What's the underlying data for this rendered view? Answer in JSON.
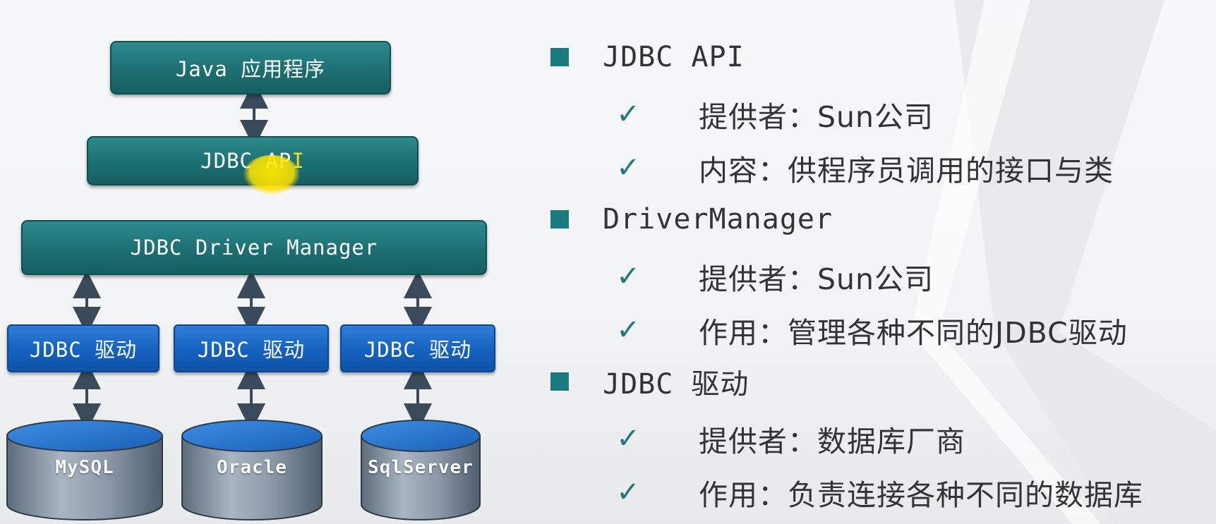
{
  "diagram": {
    "app_box": {
      "label": "Java 应用程序"
    },
    "api_box": {
      "label_main": "JDBC AP",
      "label_highlight": "I"
    },
    "manager_box": {
      "label": "JDBC Driver Manager"
    },
    "drivers": [
      {
        "label": "JDBC 驱动"
      },
      {
        "label": "JDBC 驱动"
      },
      {
        "label": "JDBC 驱动"
      }
    ],
    "databases": [
      {
        "label": "MySQL"
      },
      {
        "label": "Oracle"
      },
      {
        "label": "SqlServer"
      }
    ],
    "colors": {
      "teal_box": "#1c6f72",
      "blue_box": "#1561bf",
      "cylinder": "#7a8a9a",
      "arrow": "#3a4a5a",
      "highlight": "#ffe800"
    }
  },
  "bullets": {
    "icon_square": "square-bullet-icon",
    "icon_check": "check-icon",
    "check_glyph": "✓",
    "sections": [
      {
        "heading": "JDBC API",
        "items": [
          "提供者：Sun公司",
          "内容：供程序员调用的接口与类"
        ]
      },
      {
        "heading": "DriverManager",
        "items": [
          "提供者：Sun公司",
          "作用：管理各种不同的JDBC驱动"
        ]
      },
      {
        "heading": "JDBC 驱动",
        "items": [
          "提供者：数据库厂商",
          "作用：负责连接各种不同的数据库"
        ]
      }
    ],
    "colors": {
      "accent": "#1b7a7e",
      "text": "#333333"
    }
  }
}
